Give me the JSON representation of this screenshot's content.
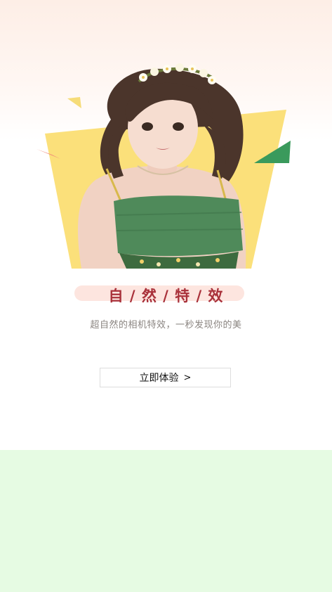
{
  "promo": {
    "title": "自 / 然 / 特 / 效",
    "subtitle": "超自然的相机特效，一秒发现你的美",
    "cta_label": "立即体验",
    "cta_arrow": ">"
  },
  "hero": {
    "image": "portrait-of-girl-with-flower-crown"
  },
  "colors": {
    "header_bg": "#fdeee6",
    "title_color": "#a9313a",
    "title_pill": "#fde5df",
    "accent_yellow": "#fbe07a",
    "accent_green": "#3a9a5c",
    "accent_salmon": "#f08a7a",
    "bottom_panel": "#e6fbe3"
  }
}
